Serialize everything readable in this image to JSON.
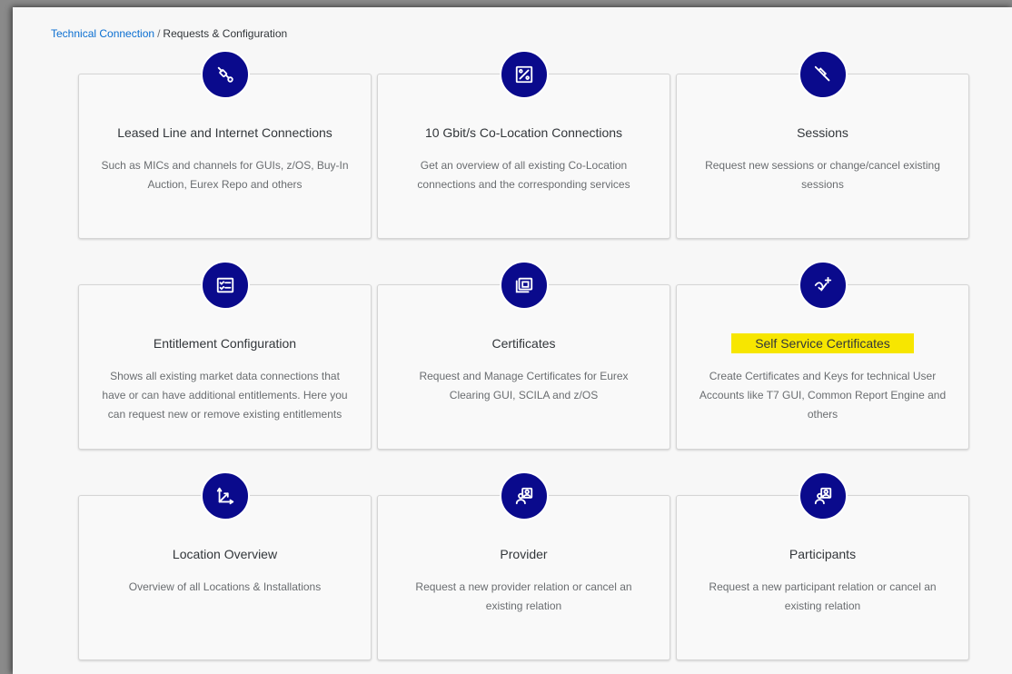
{
  "breadcrumb": {
    "parent": "Technical Connection",
    "separator": "/",
    "current": "Requests & Configuration"
  },
  "colors": {
    "icon_background": "#0a0a8c",
    "link": "#0a6ed1",
    "highlight": "#f7e600"
  },
  "tiles": [
    {
      "icon": "plug-icon",
      "title": "Leased Line and Internet Connections",
      "description": "Such as MICs and channels for GUIs, z/OS, Buy-In Auction, Eurex Repo and others"
    },
    {
      "icon": "network-map-icon",
      "title": "10 Gbit/s Co-Location Connections",
      "description": "Get an overview of all existing Co-Location connections and the corresponding services"
    },
    {
      "icon": "disconnected-plug-icon",
      "title": "Sessions",
      "description": "Request new sessions or change/cancel existing sessions"
    },
    {
      "icon": "checklist-icon",
      "title": "Entitlement Configuration",
      "description": "Shows all existing market data connections that have or can have additional entitlements. Here you can request new or remove existing entitlements"
    },
    {
      "icon": "certificate-copy-icon",
      "title": "Certificates",
      "description": "Request and Manage Certificates for Eurex Clearing GUI, SCILA and z/OS"
    },
    {
      "icon": "add-connection-icon",
      "title": "Self Service Certificates",
      "highlighted": true,
      "description": "Create Certificates and Keys for technical User Accounts like T7 GUI, Common Report Engine and others"
    },
    {
      "icon": "axes-arrows-icon",
      "title": "Location Overview",
      "description": "Overview of all Locations & Installations"
    },
    {
      "icon": "group-contacts-icon",
      "title": "Provider",
      "description": "Request a new provider relation or cancel an existing relation"
    },
    {
      "icon": "group-contacts-icon",
      "title": "Participants",
      "description": "Request a new participant relation or cancel an existing relation"
    }
  ]
}
